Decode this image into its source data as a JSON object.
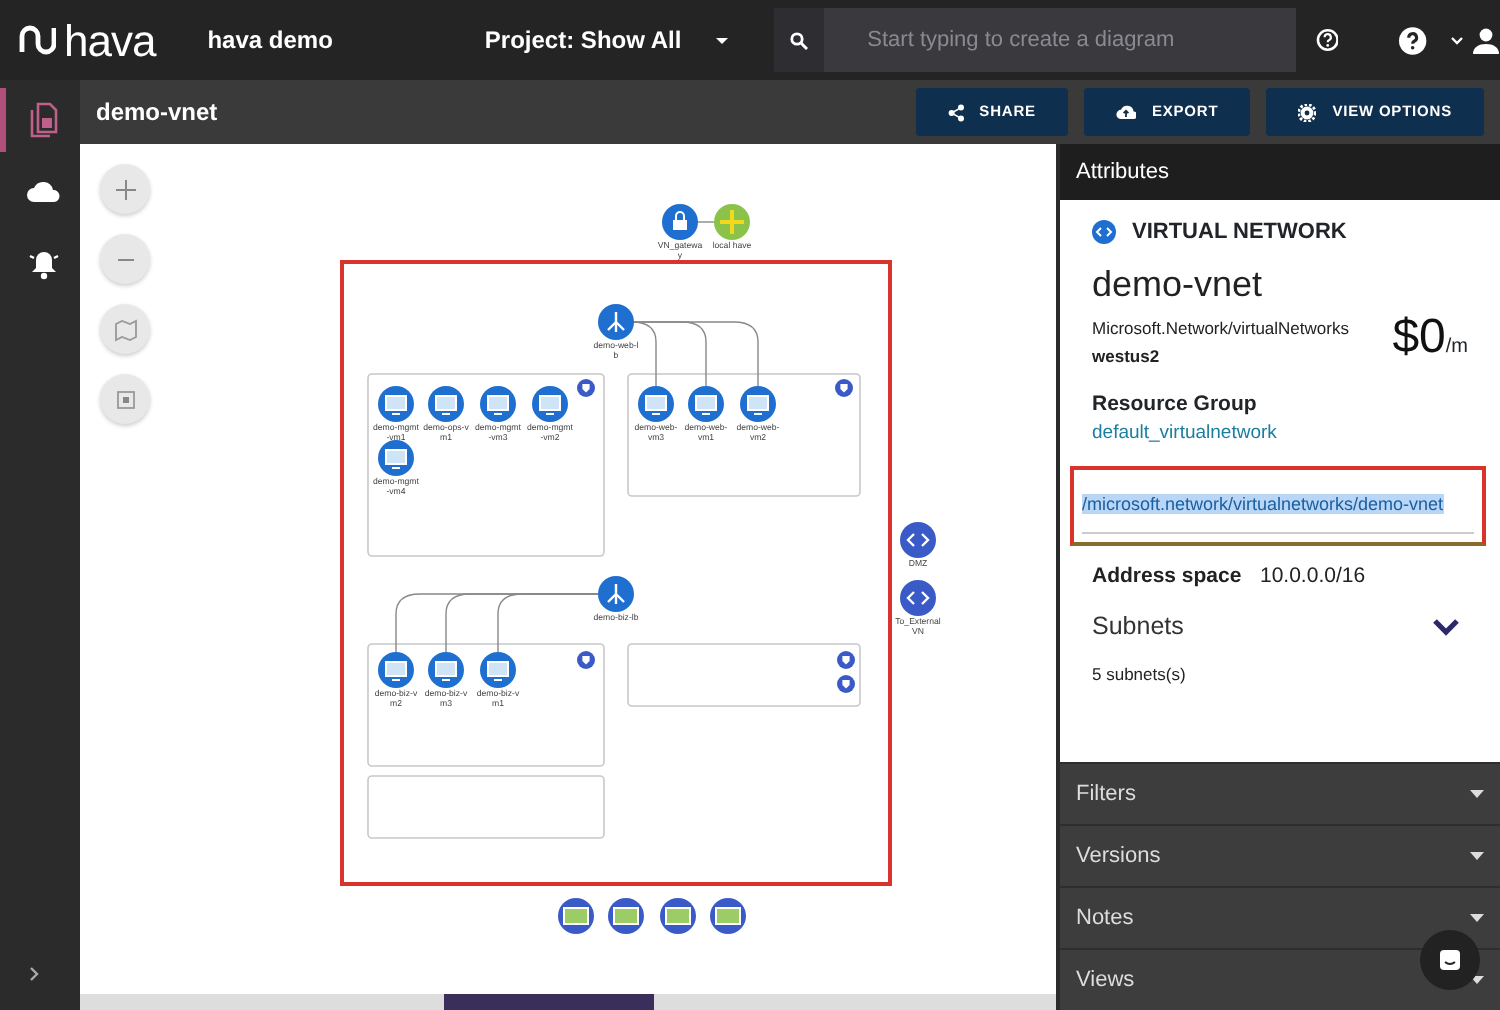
{
  "top_bar": {
    "logo": "hava",
    "workspace": "hava demo",
    "project": "Project: Show All",
    "search": {
      "placeholder": "Start typing to create a diagram"
    }
  },
  "sidebar": {
    "items": [
      {
        "kind": "diagrams",
        "selected": true
      },
      {
        "kind": "cloud",
        "selected": false
      },
      {
        "kind": "alerts",
        "selected": false
      }
    ]
  },
  "header": {
    "title": "demo-vnet",
    "buttons": [
      {
        "label": "SHARE",
        "kind": "share"
      },
      {
        "label": "EXPORT",
        "kind": "export"
      },
      {
        "label": "VIEW OPTIONS",
        "kind": "settings"
      }
    ]
  },
  "diagram": {
    "nodes": [
      {
        "label": "VN_gateway",
        "kind": "gateway"
      },
      {
        "label": "local have",
        "kind": "local"
      },
      {
        "label": "demo-web-lb",
        "kind": "lb"
      },
      {
        "label": "demo-mgmt-vm1",
        "kind": "vm"
      },
      {
        "label": "demo-ops-vm1",
        "kind": "vm"
      },
      {
        "label": "demo-mgmt-vm3",
        "kind": "vm"
      },
      {
        "label": "demo-mgmt-vm2",
        "kind": "vm"
      },
      {
        "label": "demo-mgmt-vm4",
        "kind": "vm"
      },
      {
        "label": "demo-web-vm3",
        "kind": "vm"
      },
      {
        "label": "demo-web-vm1",
        "kind": "vm"
      },
      {
        "label": "demo-web-vm2",
        "kind": "vm"
      },
      {
        "label": "DMZ",
        "kind": "vnet"
      },
      {
        "label": "To_External VN",
        "kind": "vnet"
      },
      {
        "label": "demo-biz-lb",
        "kind": "lb"
      },
      {
        "label": "demo-biz-vm2",
        "kind": "vm"
      },
      {
        "label": "demo-biz-vm3",
        "kind": "vm"
      },
      {
        "label": "demo-biz-vm1",
        "kind": "vm"
      },
      {
        "kind": "storage"
      },
      {
        "kind": "storage"
      },
      {
        "kind": "storage"
      },
      {
        "kind": "storage"
      }
    ]
  },
  "attributes": {
    "title": "Attributes",
    "type": "VIRTUAL NETWORK",
    "name": "demo-vnet",
    "resource_type": "Microsoft.Network/virtualNetworks",
    "location": "westus2",
    "cost": "$0",
    "cost_unit": "/m",
    "resource_group_label": "Resource Group",
    "resource_group": "default_virtualnetwork",
    "id": "/microsoft.network/virtualnetworks/demo-vnet",
    "address_label": "Address space",
    "address": "10.0.0.0/16",
    "subnets_label": "Subnets",
    "subnets_count": "5 subnets(s)",
    "subnets_expanded": false
  },
  "sections": [
    {
      "label": "Filters"
    },
    {
      "label": "Versions"
    },
    {
      "label": "Notes"
    },
    {
      "label": "Views"
    }
  ]
}
